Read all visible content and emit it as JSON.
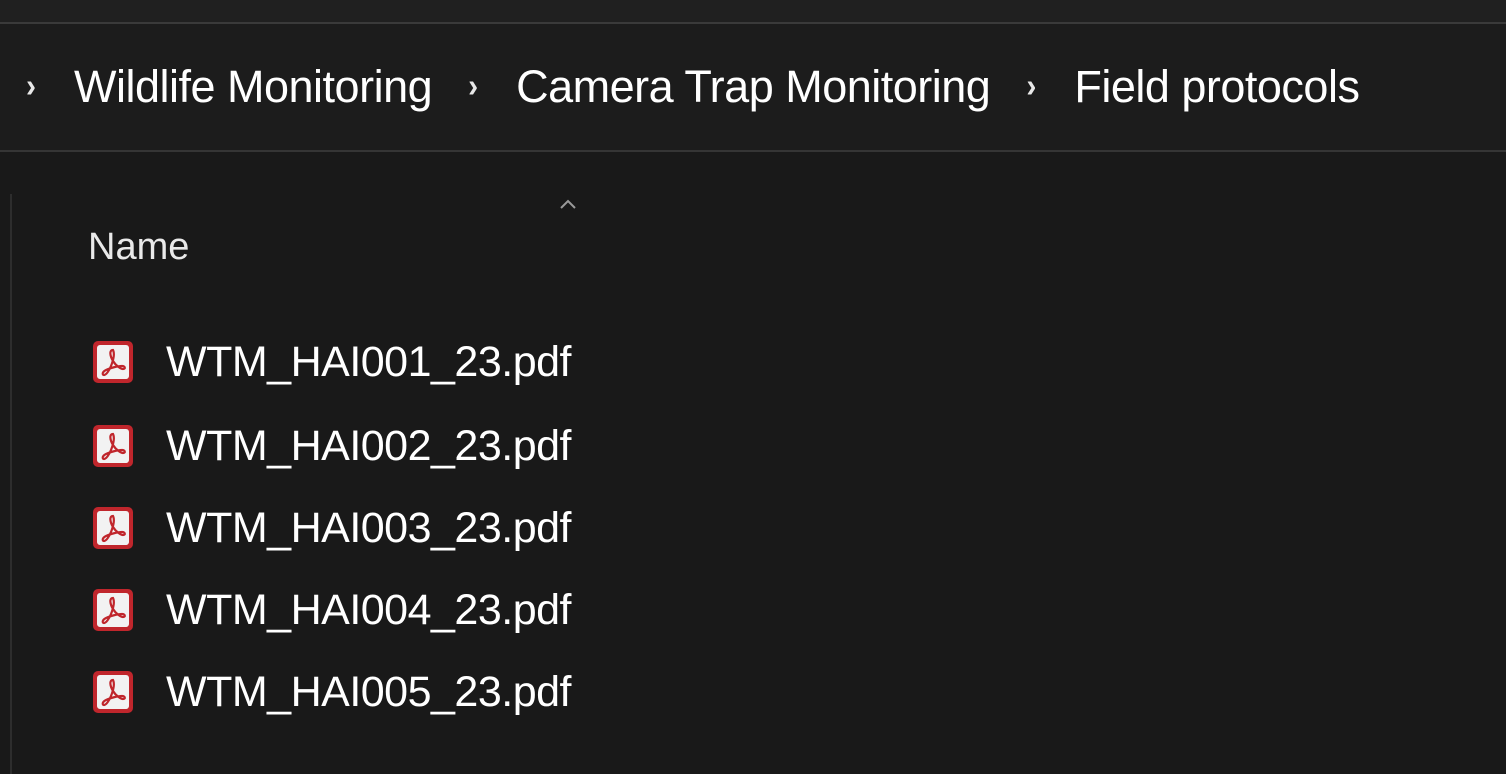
{
  "breadcrumb": {
    "items": [
      {
        "label": "Wildlife Monitoring"
      },
      {
        "label": "Camera Trap Monitoring"
      },
      {
        "label": "Field protocols"
      }
    ]
  },
  "list": {
    "column_header": "Name",
    "sort_direction": "ascending",
    "files": [
      {
        "name": "WTM_HAI001_23.pdf",
        "icon": "pdf-file-icon"
      },
      {
        "name": "WTM_HAI002_23.pdf",
        "icon": "pdf-file-icon"
      },
      {
        "name": "WTM_HAI003_23.pdf",
        "icon": "pdf-file-icon"
      },
      {
        "name": "WTM_HAI004_23.pdf",
        "icon": "pdf-file-icon"
      },
      {
        "name": "WTM_HAI005_23.pdf",
        "icon": "pdf-file-icon"
      }
    ]
  },
  "colors": {
    "background": "#191919",
    "text": "#ffffff",
    "pdf_icon_red": "#c0262c"
  }
}
